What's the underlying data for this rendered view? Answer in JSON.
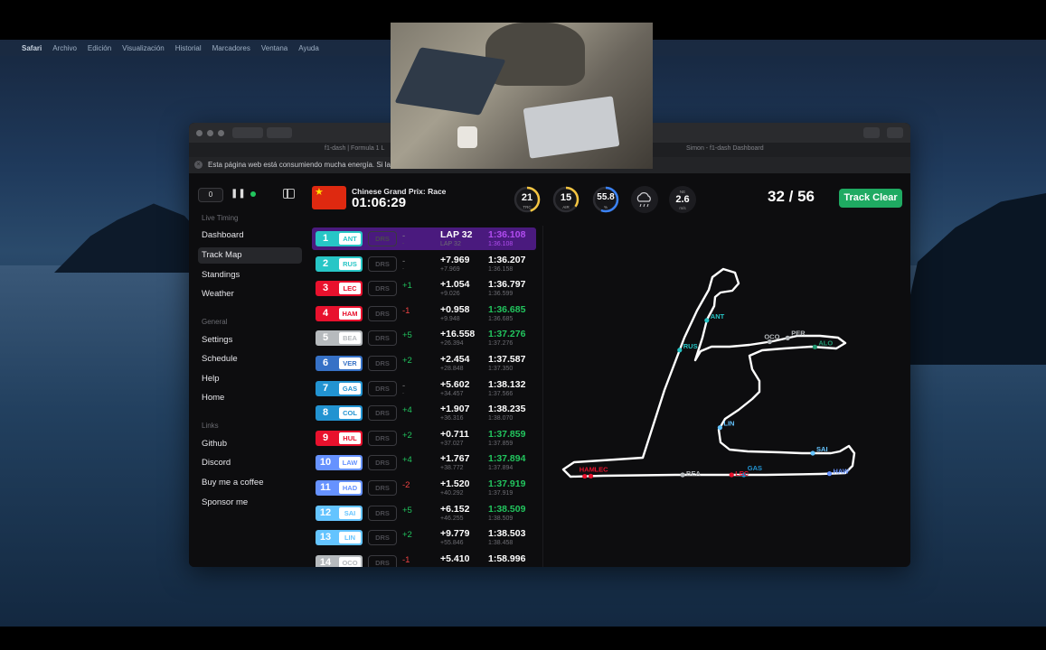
{
  "menubar": {
    "apple": "",
    "items": [
      "Safari",
      "Archivo",
      "Edición",
      "Visualización",
      "Historial",
      "Marcadores",
      "Ventana",
      "Ayuda"
    ]
  },
  "browser": {
    "tabs": [
      "f1-dash | Formula 1 L",
      "Simon - f1-dash Dashboard"
    ],
    "notice": "Esta página web está consumiendo mucha energía. Si la"
  },
  "sidebar": {
    "delay_value": "0",
    "pause_glyph": "❚❚",
    "sections": [
      {
        "title": "Live Timing",
        "items": [
          "Dashboard",
          "Track Map",
          "Standings",
          "Weather"
        ]
      },
      {
        "title": "General",
        "items": [
          "Settings",
          "Schedule",
          "Help",
          "Home"
        ]
      },
      {
        "title": "Links",
        "items": [
          "Github",
          "Discord",
          "Buy me a coffee",
          "Sponsor me"
        ]
      }
    ],
    "active_item": "Track Map"
  },
  "session": {
    "name": "Chinese Grand Prix: Race",
    "clock": "01:06:29",
    "flag_icon": "china-flag-icon"
  },
  "weather": {
    "track_temp": {
      "value": "21",
      "unit": "TRC",
      "fraction": 0.45,
      "color": "#f5c542"
    },
    "air_temp": {
      "value": "15",
      "unit": "AIR",
      "fraction": 0.35,
      "color": "#f5c542"
    },
    "humidity": {
      "value": "55.8",
      "unit": "%",
      "fraction": 0.56,
      "color": "#3b82f6"
    },
    "rain_icon": "cloud-rain-icon",
    "wind": {
      "direction": "NE",
      "value": "2.6",
      "unit": "m/s"
    }
  },
  "laps": "32 / 56",
  "track_status": "Track Clear",
  "drs_label": "DRS",
  "drivers": [
    {
      "pos": "1",
      "tla": "ANT",
      "color": "#27c6c6",
      "change": "-",
      "change_sub": "-",
      "change_dir": "none",
      "gap": "LAP 32",
      "gap_sub": "LAP 32",
      "lap": "1:36.108",
      "lap_sub": "1:36.108",
      "lap_state": "fastest"
    },
    {
      "pos": "2",
      "tla": "RUS",
      "color": "#27c6c6",
      "change": "-",
      "change_sub": "-",
      "change_dir": "none",
      "gap": "+7.969",
      "gap_sub": "+7.969",
      "lap": "1:36.207",
      "lap_sub": "1:36.158",
      "lap_state": "normal"
    },
    {
      "pos": "3",
      "tla": "LEC",
      "color": "#e8112d",
      "change": "+1",
      "change_sub": "",
      "change_dir": "up",
      "gap": "+1.054",
      "gap_sub": "+9.026",
      "lap": "1:36.797",
      "lap_sub": "1:36.599",
      "lap_state": "normal"
    },
    {
      "pos": "4",
      "tla": "HAM",
      "color": "#e8112d",
      "change": "-1",
      "change_sub": "",
      "change_dir": "down",
      "gap": "+0.958",
      "gap_sub": "+9.948",
      "lap": "1:36.685",
      "lap_sub": "1:36.685",
      "lap_state": "personal"
    },
    {
      "pos": "5",
      "tla": "BEA",
      "color": "#b6babd",
      "change": "+5",
      "change_sub": "",
      "change_dir": "up",
      "gap": "+16.558",
      "gap_sub": "+26.394",
      "lap": "1:37.276",
      "lap_sub": "1:37.276",
      "lap_state": "personal"
    },
    {
      "pos": "6",
      "tla": "VER",
      "color": "#3671c6",
      "change": "+2",
      "change_sub": "",
      "change_dir": "up",
      "gap": "+2.454",
      "gap_sub": "+28.848",
      "lap": "1:37.587",
      "lap_sub": "1:37.350",
      "lap_state": "normal"
    },
    {
      "pos": "7",
      "tla": "GAS",
      "color": "#2293d1",
      "change": "-",
      "change_sub": "-",
      "change_dir": "none",
      "gap": "+5.602",
      "gap_sub": "+34.457",
      "lap": "1:38.132",
      "lap_sub": "1:37.566",
      "lap_state": "normal"
    },
    {
      "pos": "8",
      "tla": "COL",
      "color": "#2293d1",
      "change": "+4",
      "change_sub": "",
      "change_dir": "up",
      "gap": "+1.907",
      "gap_sub": "+36.316",
      "lap": "1:38.235",
      "lap_sub": "1:38.070",
      "lap_state": "normal"
    },
    {
      "pos": "9",
      "tla": "HUL",
      "color": "#e8112d",
      "change": "+2",
      "change_sub": "",
      "change_dir": "up",
      "gap": "+0.711",
      "gap_sub": "+37.027",
      "lap": "1:37.859",
      "lap_sub": "1:37.859",
      "lap_state": "personal"
    },
    {
      "pos": "10",
      "tla": "LAW",
      "color": "#6692ff",
      "change": "+4",
      "change_sub": "",
      "change_dir": "up",
      "gap": "+1.767",
      "gap_sub": "+38.772",
      "lap": "1:37.894",
      "lap_sub": "1:37.894",
      "lap_state": "personal"
    },
    {
      "pos": "11",
      "tla": "HAD",
      "color": "#6692ff",
      "change": "-2",
      "change_sub": "",
      "change_dir": "down",
      "gap": "+1.520",
      "gap_sub": "+40.292",
      "lap": "1:37.919",
      "lap_sub": "1:37.919",
      "lap_state": "personal"
    },
    {
      "pos": "12",
      "tla": "SAI",
      "color": "#64c4ff",
      "change": "+5",
      "change_sub": "",
      "change_dir": "up",
      "gap": "+6.152",
      "gap_sub": "+46.255",
      "lap": "1:38.509",
      "lap_sub": "1:38.509",
      "lap_state": "personal"
    },
    {
      "pos": "13",
      "tla": "LIN",
      "color": "#64c4ff",
      "change": "+2",
      "change_sub": "",
      "change_dir": "up",
      "gap": "+9.779",
      "gap_sub": "+55.846",
      "lap": "1:38.503",
      "lap_sub": "1:38.458",
      "lap_state": "normal"
    },
    {
      "pos": "14",
      "tla": "OCO",
      "color": "#b6babd",
      "change": "-1",
      "change_sub": "",
      "change_dir": "down",
      "gap": "+5.410",
      "gap_sub": "",
      "lap": "1:58.996",
      "lap_sub": "",
      "lap_state": "normal"
    }
  ],
  "track_map": {
    "line_color": "#ffffff",
    "markers": [
      {
        "label": "ANT",
        "color": "#27c6c6"
      },
      {
        "label": "ALO",
        "color": "#229971"
      },
      {
        "label": "OCO",
        "color": "#b6babd"
      },
      {
        "label": "PER",
        "color": "#b6babd"
      },
      {
        "label": "LIN",
        "color": "#64c4ff"
      },
      {
        "label": "RUS",
        "color": "#27c6c6"
      },
      {
        "label": "SAI",
        "color": "#64c4ff"
      },
      {
        "label": "HAW",
        "color": "#6692ff"
      },
      {
        "label": "GAS",
        "color": "#2293d1"
      },
      {
        "label": "LEC",
        "color": "#e8112d"
      },
      {
        "label": "BEA",
        "color": "#b6babd"
      },
      {
        "label": "HAM",
        "color": "#e8112d"
      },
      {
        "label": "LEC",
        "color": "#e8112d"
      }
    ]
  }
}
